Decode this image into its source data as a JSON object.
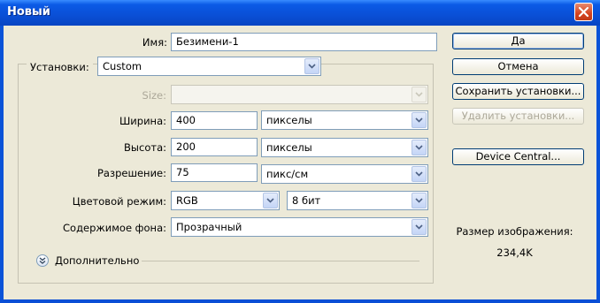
{
  "window": {
    "title": "Новый"
  },
  "form": {
    "name_label": "Имя:",
    "name_value": "Безимени-1",
    "preset_label": "Установки:",
    "preset_value": "Custom",
    "size_label": "Size:",
    "size_value": "",
    "width_label": "Ширина:",
    "width_value": "400",
    "width_unit": "пикселы",
    "height_label": "Высота:",
    "height_value": "200",
    "height_unit": "пикселы",
    "resolution_label": "Разрешение:",
    "resolution_value": "75",
    "resolution_unit": "пикс/см",
    "color_mode_label": "Цветовой режим:",
    "color_mode_value": "RGB",
    "bit_depth_value": "8 бит",
    "background_label": "Содержимое фона:",
    "background_value": "Прозрачный",
    "advanced_label": "Дополнительно"
  },
  "buttons": {
    "ok": "Да",
    "cancel": "Отмена",
    "save_preset": "Сохранить установки...",
    "delete_preset": "Удалить установки...",
    "device_central": "Device Central..."
  },
  "info": {
    "image_size_label": "Размер изображения:",
    "image_size_value": "234,4K"
  },
  "colors": {
    "titlebar": "#0a4fd6",
    "dialog_bg": "#ece9d8",
    "close_button": "#d5431f"
  }
}
